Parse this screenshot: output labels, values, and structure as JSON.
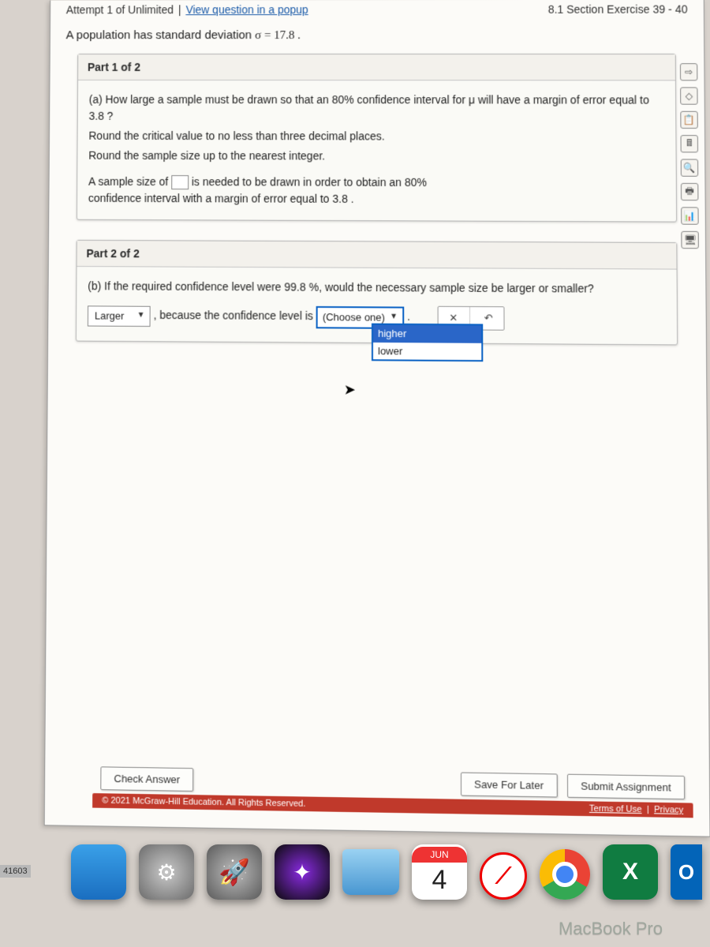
{
  "header": {
    "attempt": "Attempt 1 of Unlimited",
    "popup_link": "View question in a popup",
    "section": "8.1 Section Exercise 39 - 40"
  },
  "intro_pre": "A population has standard deviation ",
  "intro_sigma": "σ = 17.8 .",
  "part1": {
    "title": "Part 1 of 2",
    "q1": "(a) How large a sample must be drawn so that an 80% confidence interval for μ will have a margin of error equal to 3.8 ?",
    "q2": "Round the critical value to no less than three decimal places.",
    "q3": "Round the sample size up to the nearest integer.",
    "ans_pre": "A sample size of ",
    "ans_post1": " is needed to be drawn in order to obtain an 80%",
    "ans_post2": "confidence interval with a margin of error equal to 3.8 ."
  },
  "part2": {
    "title": "Part 2 of 2",
    "q": "(b) If the required confidence level were 99.8 %, would the necessary sample size be larger or smaller?",
    "sel1_value": "Larger",
    "mid": ", because the confidence level is ",
    "sel2_placeholder": "(Choose one)",
    "options": [
      "higher",
      "lower"
    ],
    "clear_x": "✕",
    "undo": "↶"
  },
  "bottom": {
    "check": "Check Answer",
    "save": "Save For Later",
    "submit": "Submit Assignment",
    "copyright": "© 2021 McGraw-Hill Education. All Rights Reserved.",
    "terms": "Terms of Use",
    "privacy": "Privacy"
  },
  "rail_icons": [
    "⇨",
    "◇",
    "📋",
    "🖩",
    "🔍",
    "🖶",
    "📊",
    "🖥"
  ],
  "dock": {
    "cal_month": "JUN",
    "cal_day": "4",
    "excel": "X",
    "out": "O"
  },
  "left_badge": "41603",
  "macbook": "MacBook Pro"
}
